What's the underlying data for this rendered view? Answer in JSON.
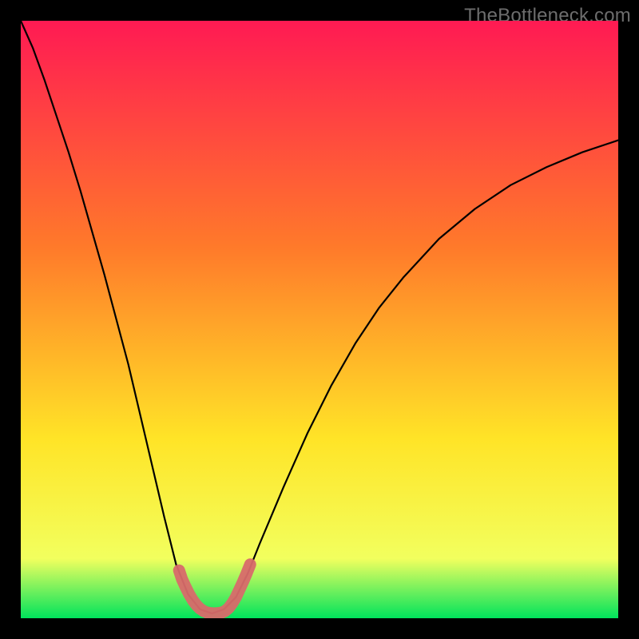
{
  "watermark": "TheBottleneck.com",
  "chart_data": {
    "type": "line",
    "title": "",
    "xlabel": "",
    "ylabel": "",
    "xlim": [
      0,
      100
    ],
    "ylim": [
      0,
      100
    ],
    "grid": false,
    "series": [
      {
        "name": "bottleneck-curve",
        "x": [
          0,
          2,
          4,
          6,
          8,
          10,
          12,
          14,
          16,
          18,
          20,
          22,
          24,
          26,
          28,
          30,
          32,
          34,
          36,
          38,
          40,
          44,
          48,
          52,
          56,
          60,
          64,
          70,
          76,
          82,
          88,
          94,
          100
        ],
        "y": [
          100,
          95.5,
          90,
          84,
          78,
          71.5,
          64.5,
          57.5,
          50,
          42.5,
          34,
          25.5,
          17,
          9,
          4,
          1.5,
          0.8,
          1.5,
          3.5,
          7.5,
          12.5,
          22,
          31,
          39,
          46,
          52,
          57,
          63.5,
          68.5,
          72.5,
          75.5,
          78,
          80
        ]
      },
      {
        "name": "highlight-band",
        "x": [
          26.5,
          27.0,
          27.6,
          28.2,
          28.8,
          29.4,
          30.0,
          30.6,
          31.2,
          31.8,
          32.4,
          33.0,
          33.6,
          34.2,
          34.8,
          35.4,
          36.0,
          36.6,
          37.2,
          37.8,
          38.4
        ],
        "y": [
          8.0,
          6.5,
          5.2,
          4.0,
          3.0,
          2.2,
          1.6,
          1.2,
          0.95,
          0.85,
          0.8,
          0.85,
          0.95,
          1.2,
          1.7,
          2.5,
          3.5,
          4.8,
          6.1,
          7.5,
          9.0
        ]
      }
    ],
    "background_gradient": {
      "top": "#ff1a53",
      "mid1": "#ff7a2a",
      "mid2": "#ffe427",
      "lower": "#f2ff5e",
      "bottom": "#00e35c"
    }
  }
}
